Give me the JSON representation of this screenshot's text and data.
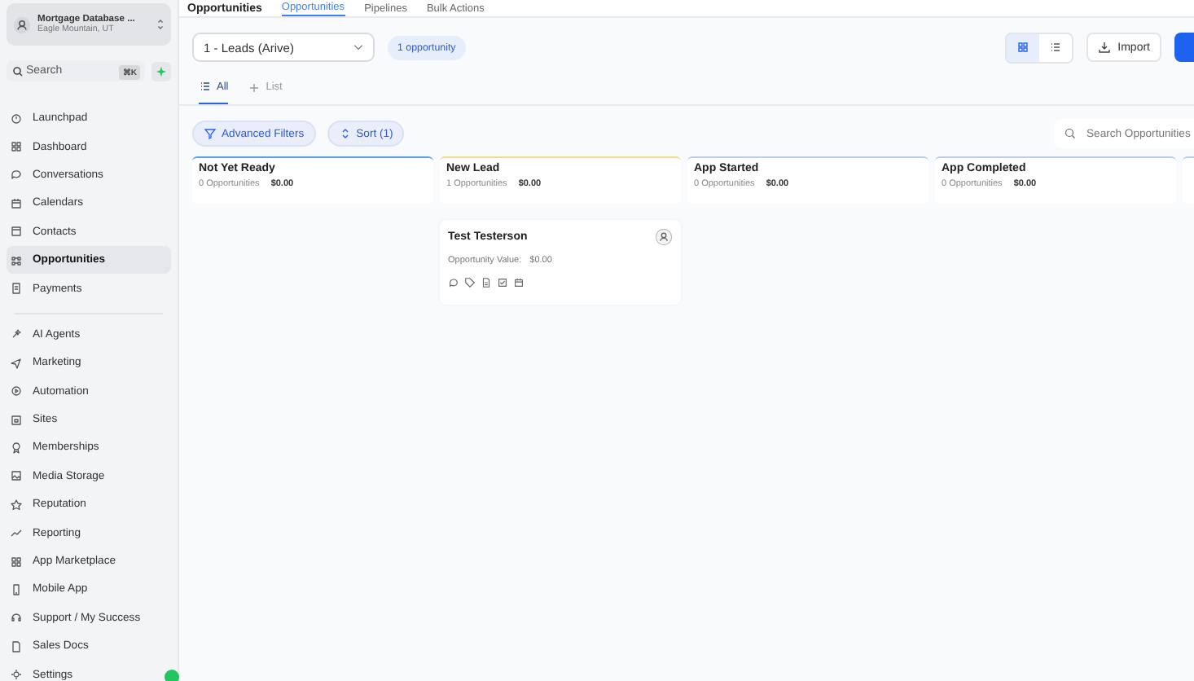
{
  "sidebar": {
    "account": {
      "name": "Mortgage Database ...",
      "location": "Eagle Mountain, UT"
    },
    "search": {
      "placeholder": "Search",
      "shortcut": "⌘K"
    },
    "items": [
      {
        "label": "Launchpad",
        "selected": false
      },
      {
        "label": "Dashboard",
        "selected": false
      },
      {
        "label": "Conversations",
        "selected": false
      },
      {
        "label": "Calendars",
        "selected": false
      },
      {
        "label": "Contacts",
        "selected": false
      },
      {
        "label": "Opportunities",
        "selected": true
      },
      {
        "label": "Payments",
        "selected": false
      }
    ],
    "items_2": [
      {
        "label": "AI Agents",
        "selected": false
      },
      {
        "label": "Marketing",
        "selected": false
      },
      {
        "label": "Automation",
        "selected": false
      },
      {
        "label": "Sites",
        "selected": false
      },
      {
        "label": "Memberships",
        "selected": false
      },
      {
        "label": "Media Storage",
        "selected": false
      },
      {
        "label": "Reputation",
        "selected": false
      },
      {
        "label": "Reporting",
        "selected": false
      },
      {
        "label": "App Marketplace",
        "selected": false
      },
      {
        "label": "Mobile App",
        "selected": false
      },
      {
        "label": "Support / My Success",
        "selected": false
      },
      {
        "label": "Sales Docs",
        "selected": false
      },
      {
        "label": "Settings",
        "selected": false
      }
    ]
  },
  "header": {
    "title": "Opportunities",
    "tabs": [
      {
        "label": "Opportunities",
        "selected": true
      },
      {
        "label": "Pipelines",
        "selected": false
      },
      {
        "label": "Bulk Actions",
        "selected": false
      }
    ]
  },
  "toolbar": {
    "pipeline": "1 - Leads (Arive)",
    "count": "1 opportunity",
    "import": "Import"
  },
  "views": [
    {
      "label": "All",
      "selected": true
    },
    {
      "label": "List",
      "selected": false
    }
  ],
  "filters": [
    "Advanced Filters",
    "Sort (1)"
  ],
  "search": {
    "placeholder": "Search Opportunities"
  },
  "stages": [
    {
      "name": "Not Yet Ready",
      "count": "0 Opportunities",
      "value": "$0.00",
      "color": "#5b9bf0"
    },
    {
      "name": "New Lead",
      "count": "1 Opportunities",
      "value": "$0.00",
      "color": "#f5d98a",
      "cards": [
        {
          "name": "Test Testerson",
          "label": "Opportunity Value:",
          "value": "$0.00"
        }
      ]
    },
    {
      "name": "App Started",
      "count": "0 Opportunities",
      "value": "$0.00",
      "color": "#b9cdf0"
    },
    {
      "name": "App Completed",
      "count": "0 Opportunities",
      "value": "$0.00",
      "color": "#b9cdf0"
    }
  ]
}
